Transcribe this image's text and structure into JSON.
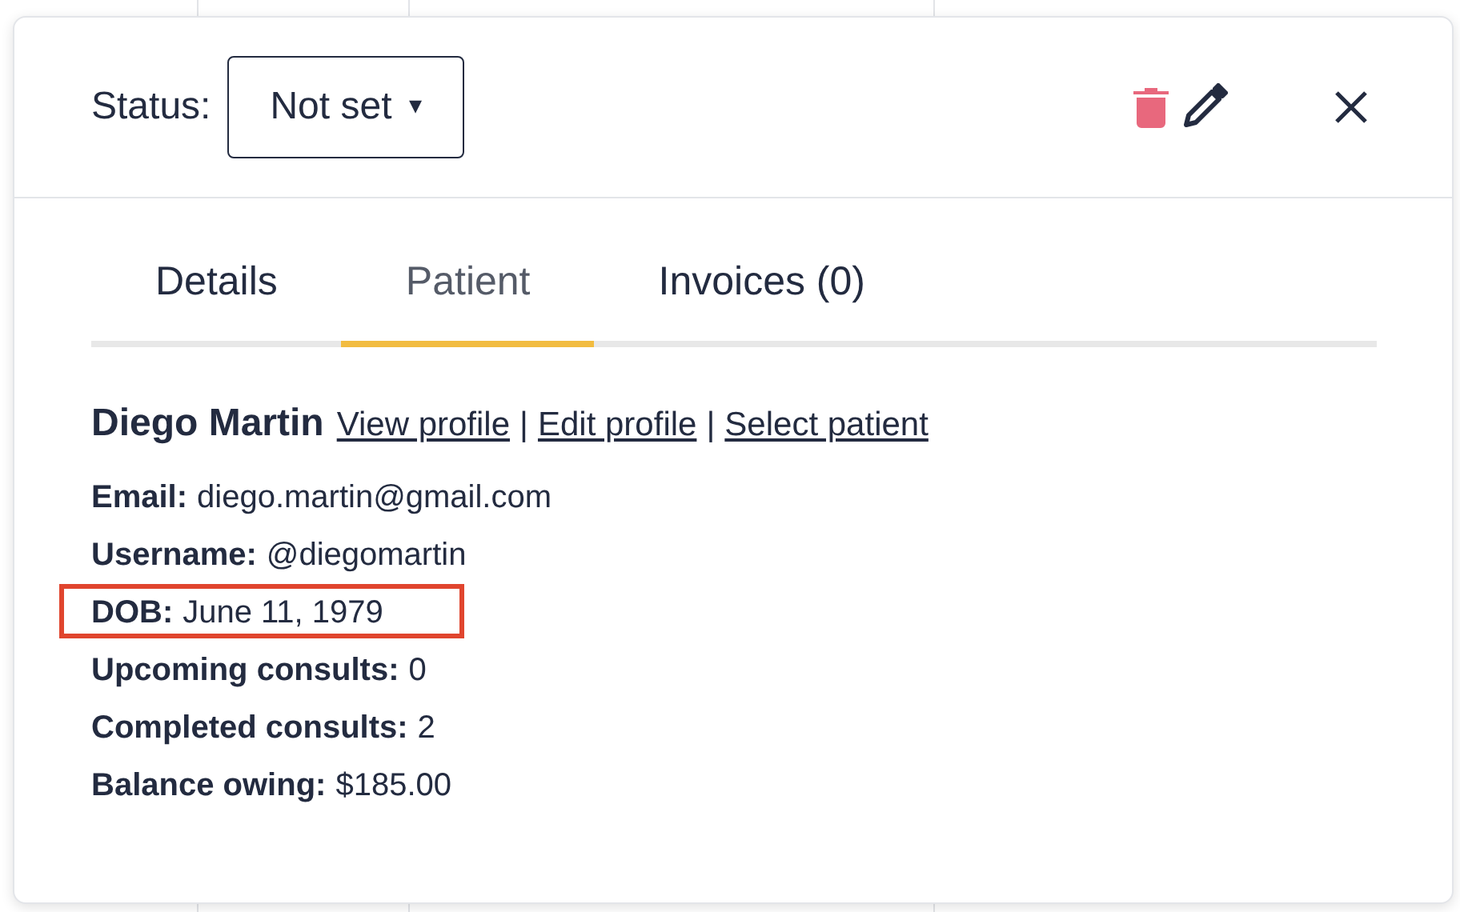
{
  "header": {
    "status_label": "Status:",
    "status_value": "Not set",
    "status_caret": "▾"
  },
  "tabs": [
    {
      "label": "Details",
      "selected": false
    },
    {
      "label": "Patient",
      "selected": true
    },
    {
      "label": "Invoices (0)",
      "selected": false
    }
  ],
  "patient": {
    "name": "Diego Martin",
    "links": [
      "View profile",
      "Edit profile",
      "Select patient"
    ],
    "separator": "|"
  },
  "fields": [
    {
      "label": "Email:",
      "value": "diego.martin@gmail.com",
      "highlighted": false
    },
    {
      "label": "Username:",
      "value": "@diegomartin",
      "highlighted": false
    },
    {
      "label": "DOB:",
      "value": "June 11, 1979",
      "highlighted": true
    },
    {
      "label": "Upcoming consults:",
      "value": "0",
      "highlighted": false
    },
    {
      "label": "Completed consults:",
      "value": "2",
      "highlighted": false
    },
    {
      "label": "Balance owing:",
      "value": "$185.00",
      "highlighted": false
    }
  ]
}
